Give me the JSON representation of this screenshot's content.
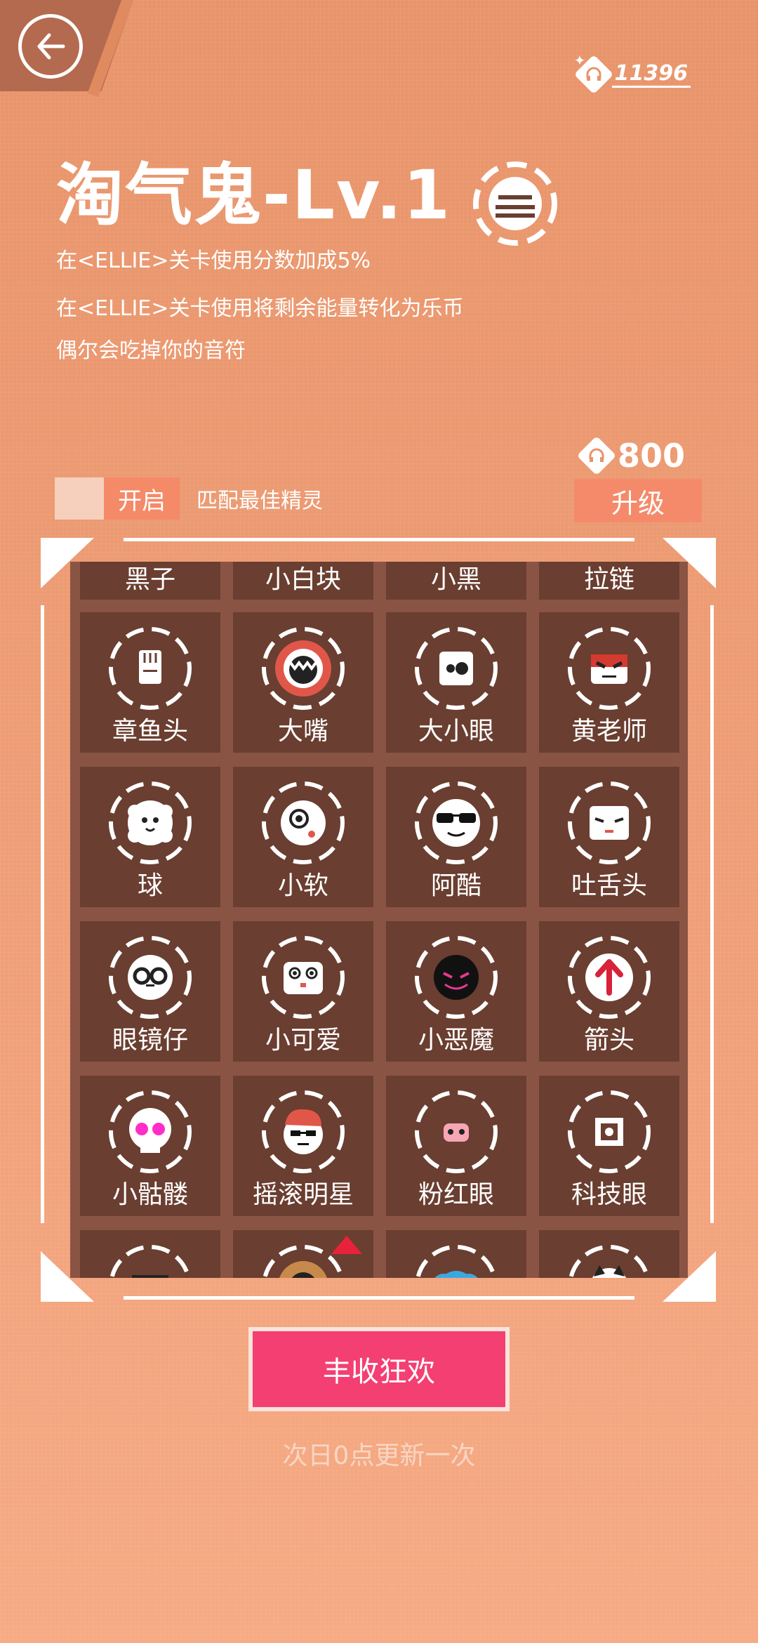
{
  "header": {
    "coins": "11396",
    "title": "淘气鬼-Lv.1",
    "descriptions": [
      "在<ELLIE>关卡使用分数加成5%",
      "在<ELLIE>关卡使用将剩余能量转化为乐币",
      "偶尔会吃掉你的音符"
    ],
    "upgrade_cost": "800",
    "open_label": "开启",
    "match_label": "匹配最佳精灵",
    "upgrade_label": "升级"
  },
  "sprites": [
    {
      "label": "黑子",
      "icon": "black-sprite-icon"
    },
    {
      "label": "小白块",
      "icon": "white-block-icon"
    },
    {
      "label": "小黑",
      "icon": "little-black-icon"
    },
    {
      "label": "拉链",
      "icon": "zipper-icon"
    },
    {
      "label": "章鱼头",
      "icon": "octopus-head-icon"
    },
    {
      "label": "大嘴",
      "icon": "big-mouth-icon"
    },
    {
      "label": "大小眼",
      "icon": "uneven-eyes-icon"
    },
    {
      "label": "黄老师",
      "icon": "teacher-huang-icon"
    },
    {
      "label": "球",
      "icon": "ball-icon"
    },
    {
      "label": "小软",
      "icon": "soft-icon"
    },
    {
      "label": "阿酷",
      "icon": "cool-sunglasses-icon"
    },
    {
      "label": "吐舌头",
      "icon": "tongue-out-icon"
    },
    {
      "label": "眼镜仔",
      "icon": "glasses-kid-icon"
    },
    {
      "label": "小可爱",
      "icon": "cutie-icon"
    },
    {
      "label": "小恶魔",
      "icon": "little-devil-icon"
    },
    {
      "label": "箭头",
      "icon": "arrow-up-icon"
    },
    {
      "label": "小骷髅",
      "icon": "skull-icon"
    },
    {
      "label": "摇滚明星",
      "icon": "rockstar-icon"
    },
    {
      "label": "粉红眼",
      "icon": "pink-eye-icon"
    },
    {
      "label": "科技眼",
      "icon": "tech-eye-icon"
    },
    {
      "label": "",
      "icon": "robot-face-icon"
    },
    {
      "label": "",
      "icon": "donut-face-icon"
    },
    {
      "label": "",
      "icon": "cloud-face-icon"
    },
    {
      "label": "",
      "icon": "cat-face-icon"
    }
  ],
  "footer": {
    "button_label": "丰收狂欢",
    "refresh_note": "次日0点更新一次"
  },
  "colors": {
    "background": "#f0a079",
    "panel": "#8a5444",
    "cell": "#6a3e30",
    "accent_pink": "#f33f72",
    "upgrade_orange": "#f58a6a"
  }
}
